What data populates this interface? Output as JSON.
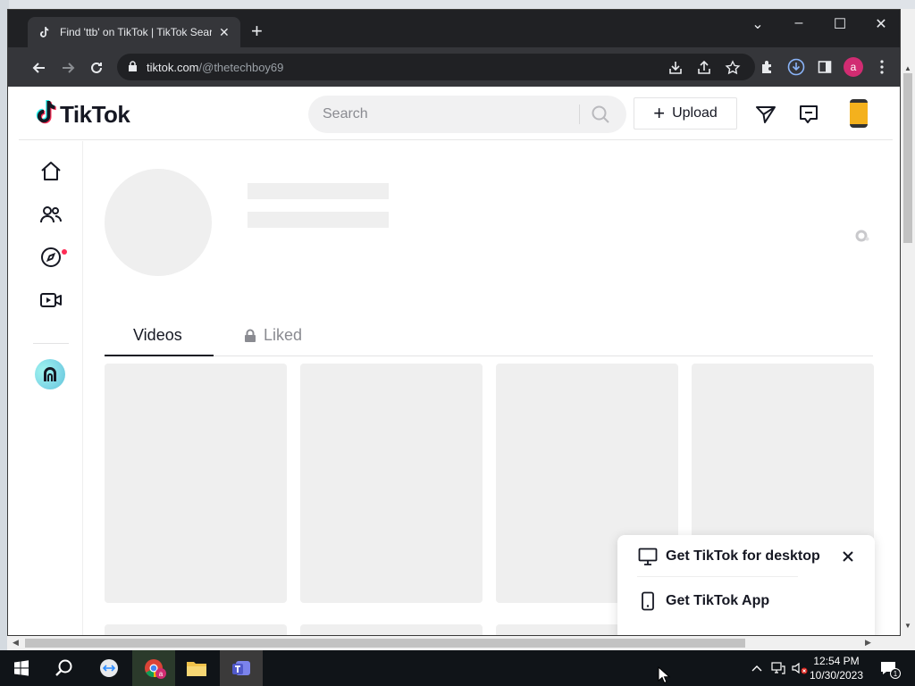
{
  "browser": {
    "tab_title": "Find 'ttb' on TikTok | TikTok Search",
    "url_host": "tiktok.com",
    "url_path": "/@thetechboy69",
    "profile_initial": "a",
    "colors": {
      "titlebar": "#202124",
      "toolbar": "#35363a",
      "profile_avatar": "#d12c72"
    }
  },
  "tiktok": {
    "logo_text": "TikTok",
    "search": {
      "placeholder": "Search"
    },
    "upload_label": "Upload",
    "sidenav": [
      {
        "name": "home-icon"
      },
      {
        "name": "following-icon"
      },
      {
        "name": "explore-icon",
        "badge": true
      },
      {
        "name": "live-icon"
      }
    ],
    "profile_tabs": [
      {
        "label": "Videos",
        "active": true
      },
      {
        "label": "Liked",
        "locked": true
      }
    ],
    "popup": {
      "desktop_label": "Get TikTok for desktop",
      "app_label": "Get TikTok App"
    },
    "colors": {
      "accent": "#fe2c55",
      "text": "#161823",
      "skeleton": "#efefef"
    }
  },
  "taskbar": {
    "time": "12:54 PM",
    "date": "10/30/2023",
    "notification_count": "1",
    "chrome_badge": "a"
  }
}
